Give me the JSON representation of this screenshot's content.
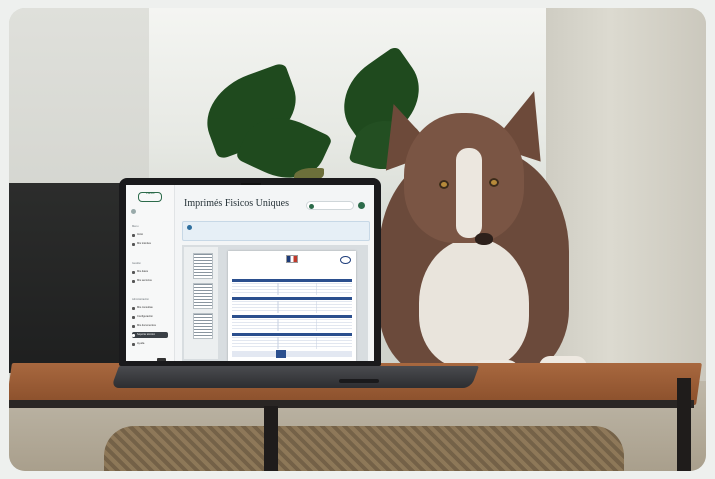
{
  "scene": {
    "subjects": [
      "dog",
      "laptop",
      "wooden-table",
      "monstera-plant",
      "woven-basket"
    ]
  },
  "laptop_screen": {
    "sidebar": {
      "brand": "Facilis",
      "groups": [
        "Menu",
        "Gestión",
        "Administración"
      ],
      "items": [
        "Inicio",
        "Mis trámites",
        "Mis datos",
        "Mis servicios",
        "Mis consultas",
        "Configuración",
        "Mis documentos",
        "Soporte técnico",
        "Ayuda"
      ]
    },
    "header": {
      "title": "Imprimés Fisicos Uniques"
    }
  },
  "colors": {
    "accent": "#2c6b4a",
    "notice_bg": "#e6eff6",
    "document_blue": "#1b3a78"
  }
}
